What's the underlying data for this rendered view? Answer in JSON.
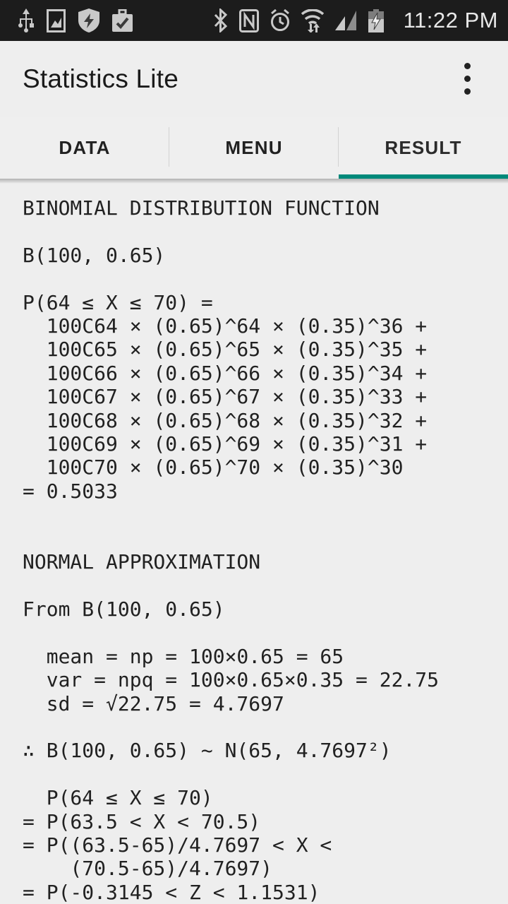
{
  "statusbar": {
    "time": "11:22 PM",
    "left_icons": [
      "usb-icon",
      "screenshot-image-icon",
      "shield-security-icon",
      "work-briefcase-icon"
    ],
    "right_icons": [
      "bluetooth-icon",
      "nfc-icon",
      "alarm-clock-icon",
      "wifi-transfer-icon",
      "cellular-signal-icon",
      "battery-charging-icon"
    ],
    "background_color": "#1c1c1c",
    "icon_color": "#c9c9c9"
  },
  "appbar": {
    "title": "Statistics Lite",
    "overflow_label": "More options"
  },
  "tabs": {
    "items": [
      {
        "label": "DATA",
        "active": false
      },
      {
        "label": "MENU",
        "active": false
      },
      {
        "label": "RESULT",
        "active": true
      }
    ],
    "indicator_color": "#00897a"
  },
  "result": {
    "lines": [
      "BINOMIAL DISTRIBUTION FUNCTION",
      "",
      "B(100, 0.65)",
      "",
      "P(64 ≤ X ≤ 70) =",
      "  100C64 × (0.65)^64 × (0.35)^36 +",
      "  100C65 × (0.65)^65 × (0.35)^35 +",
      "  100C66 × (0.65)^66 × (0.35)^34 +",
      "  100C67 × (0.65)^67 × (0.35)^33 +",
      "  100C68 × (0.65)^68 × (0.35)^32 +",
      "  100C69 × (0.65)^69 × (0.35)^31 +",
      "  100C70 × (0.65)^70 × (0.35)^30",
      "= 0.5033",
      "",
      "",
      "NORMAL APPROXIMATION",
      "",
      "From B(100, 0.65)",
      "",
      "  mean = np = 100×0.65 = 65",
      "  var = npq = 100×0.65×0.35 = 22.75",
      "  sd = √22.75 = 4.7697",
      "",
      "∴ B(100, 0.65) ~ N(65, 4.7697²)",
      "",
      "  P(64 ≤ X ≤ 70)",
      "= P(63.5 < X < 70.5)",
      "= P((63.5-65)/4.7697 < X <",
      "    (70.5-65)/4.7697)",
      "= P(-0.3145 < Z < 1.1531)"
    ]
  }
}
